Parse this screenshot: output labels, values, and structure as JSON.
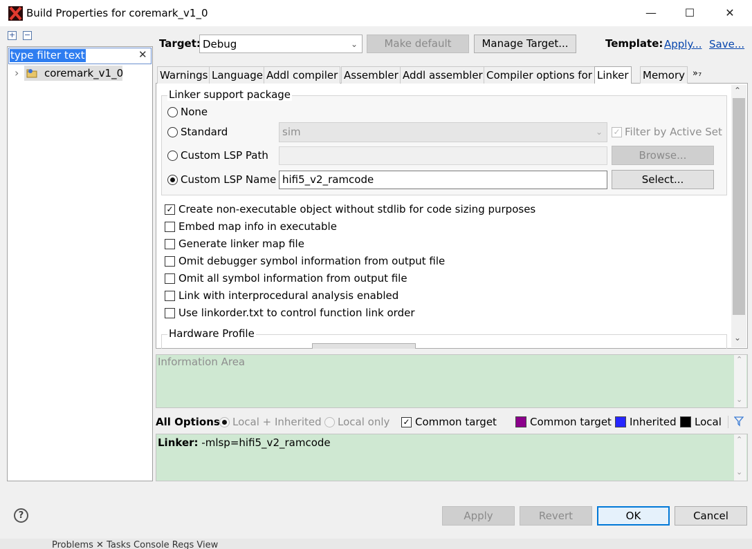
{
  "window": {
    "title": "Build Properties for coremark_v1_0",
    "minimize": "—",
    "maximize": "☐",
    "close": "✕"
  },
  "tree": {
    "filter_text": "type filter text",
    "clear": "✕",
    "expand_all": "+",
    "collapse_all": "−",
    "project": "coremark_v1_0",
    "expander": "›"
  },
  "toolbar": {
    "target_label": "Target:",
    "target_value": "Debug",
    "make_default": "Make default",
    "manage_target": "Manage Target...",
    "template_label": "Template:",
    "apply_link": "Apply...",
    "save_link": "Save..."
  },
  "tabs": [
    "Warnings",
    "Language",
    "Addl compiler",
    "Assembler",
    "Addl assembler",
    "Compiler options for",
    "Linker",
    "Memory"
  ],
  "tabs_more": "»₇",
  "lsp": {
    "group_title": "Linker support package",
    "none": "None",
    "standard": "Standard",
    "standard_value": "sim",
    "filter_active_set": "Filter by Active Set",
    "custom_path": "Custom LSP Path",
    "browse": "Browse...",
    "custom_name": "Custom LSP Name",
    "custom_name_value": "hifi5_v2_ramcode",
    "select": "Select..."
  },
  "options": [
    {
      "label": "Create non-executable object without stdlib for code sizing purposes",
      "checked": true
    },
    {
      "label": "Embed map info in executable",
      "checked": false
    },
    {
      "label": "Generate linker map file",
      "checked": false
    },
    {
      "label": "Omit debugger symbol information from output file",
      "checked": false
    },
    {
      "label": "Omit all symbol information from output file",
      "checked": false
    },
    {
      "label": "Link with interprocedural analysis enabled",
      "checked": false
    },
    {
      "label": "Use linkorder.txt to control function link order",
      "checked": false
    }
  ],
  "hardware_profile": "Hardware Profile",
  "info_area": "Information Area",
  "all_options": {
    "label": "All Options:",
    "local_inherited": "Local + Inherited",
    "local_only": "Local only",
    "common_target_check": "Common target",
    "legend_common": "Common target",
    "legend_inherited": "Inherited",
    "legend_local": "Local",
    "color_common": "#8b008b",
    "color_inherited": "#2626ff",
    "color_local": "#000000"
  },
  "command": {
    "prefix": "Linker:",
    "value": " -mlsp=hifi5_v2_ramcode"
  },
  "buttons": {
    "help": "?",
    "apply": "Apply",
    "revert": "Revert",
    "ok": "OK",
    "cancel": "Cancel"
  },
  "background_tabs": "Problems  ✕   Tasks   Console   Regs View"
}
